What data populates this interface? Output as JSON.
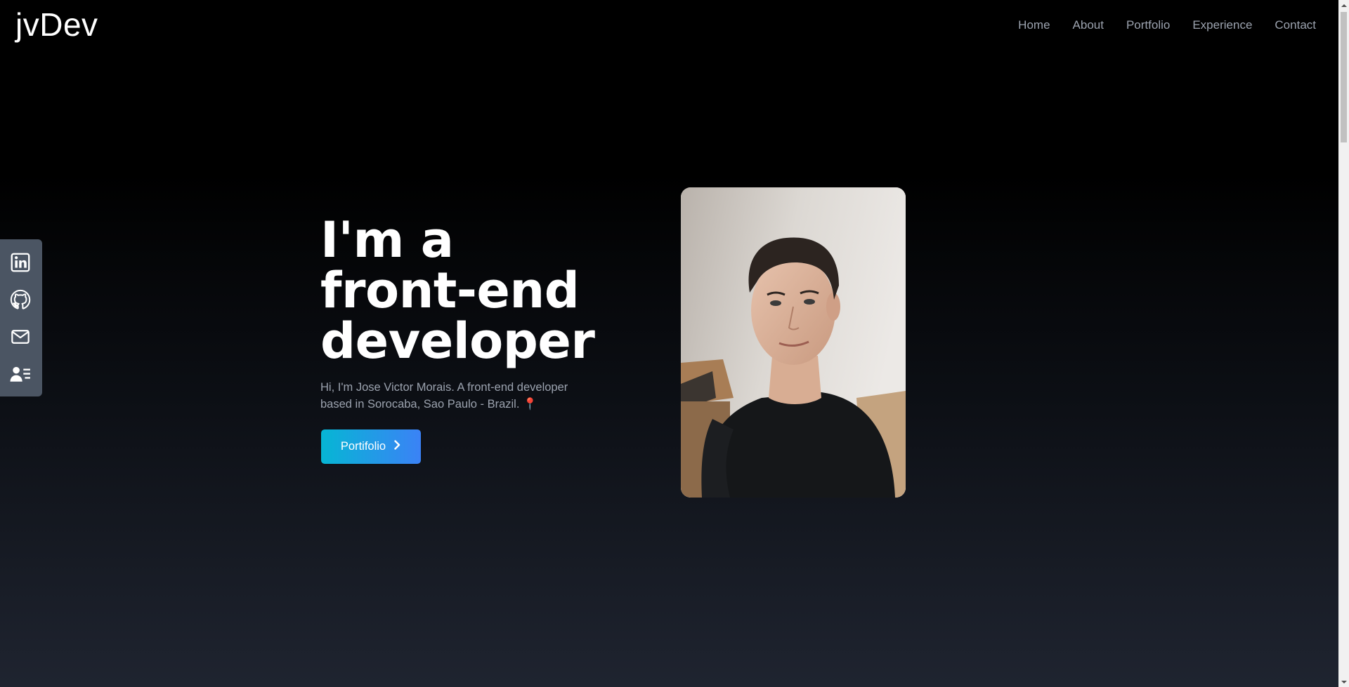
{
  "header": {
    "logo": "jvDev",
    "nav": [
      {
        "label": "Home"
      },
      {
        "label": "About"
      },
      {
        "label": "Portfolio"
      },
      {
        "label": "Experience"
      },
      {
        "label": "Contact"
      }
    ]
  },
  "social": {
    "items": [
      {
        "icon": "linkedin-icon"
      },
      {
        "icon": "github-icon"
      },
      {
        "icon": "mail-icon"
      },
      {
        "icon": "resume-icon"
      }
    ]
  },
  "hero": {
    "headline": [
      "I'm a",
      "front-end",
      "developer"
    ],
    "intro": "Hi, I'm Jose Victor Morais. A front-end developer based in Sorocaba, Sao Paulo - Brazil. 📍",
    "cta_label": "Portifolio",
    "cta_icon": "chevron-right-icon"
  },
  "colors": {
    "background_top": "#000000",
    "background_bottom": "#1f2430",
    "accent_start": "#06b6d4",
    "accent_end": "#3b82f6",
    "muted_text": "#9ca3af",
    "social_bar": "#4b5563"
  }
}
